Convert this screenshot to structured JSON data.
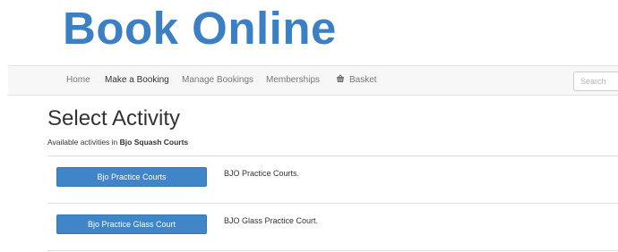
{
  "header": {
    "brand_title": "Book Online"
  },
  "nav": {
    "items": [
      {
        "label": "Home"
      },
      {
        "label": "Make a Booking"
      },
      {
        "label": "Manage Bookings"
      },
      {
        "label": "Memberships"
      },
      {
        "label": "Basket",
        "icon": "basket-icon"
      }
    ],
    "active_item": "Make a Booking",
    "search_placeholder": "Search"
  },
  "main": {
    "title": "Select Activity",
    "subtitle_prefix": "Available activities in",
    "venue_name": "Bjo Squash Courts",
    "activities": [
      {
        "button_label": "Bjo Practice Courts",
        "description": "BJO Practice Courts."
      },
      {
        "button_label": "Bjo Practice Glass Court",
        "description": "BJO Glass Practice Court."
      }
    ]
  },
  "colors": {
    "brand": "#3b7fc4",
    "button": "#3f85c8",
    "navbar_bg": "#f7f7f7"
  }
}
